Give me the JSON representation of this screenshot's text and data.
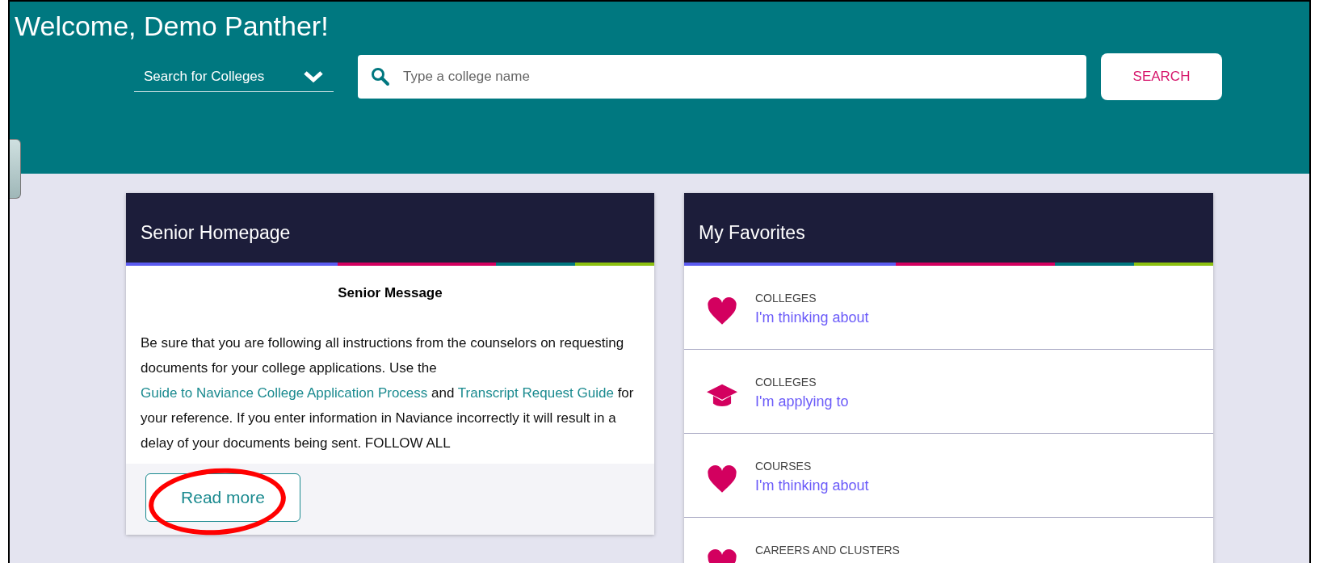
{
  "header": {
    "title": "Welcome, Demo Panther!",
    "search_type": "Search for Colleges",
    "search": {
      "placeholder": "Type a college name"
    },
    "search_button": "SEARCH"
  },
  "senior_card": {
    "title": "Senior Homepage",
    "message_title": "Senior Message",
    "message": [
      {
        "kind": "text",
        "text": "Be sure that you are following all instructions from the counselors on requesting documents for your college applications.  Use the "
      },
      {
        "kind": "link",
        "text": "Guide to Naviance College Application Process"
      },
      {
        "kind": "text",
        "text": " and "
      },
      {
        "kind": "link",
        "text": "Transcript Request Guide"
      },
      {
        "kind": "text",
        "text": " for your reference. If you enter information in Naviance incorrectly it will result in a delay of your documents being sent. FOLLOW ALL"
      }
    ],
    "read_more": "Read more"
  },
  "favorites_card": {
    "title": "My Favorites",
    "items": [
      {
        "kind": "heart",
        "category": "COLLEGES",
        "link": "I'm thinking about"
      },
      {
        "kind": "cap",
        "category": "COLLEGES",
        "link": "I'm applying to"
      },
      {
        "kind": "heart",
        "category": "COURSES",
        "link": "I'm thinking about"
      },
      {
        "kind": "heart",
        "category": "CAREERS AND CLUSTERS"
      }
    ]
  }
}
